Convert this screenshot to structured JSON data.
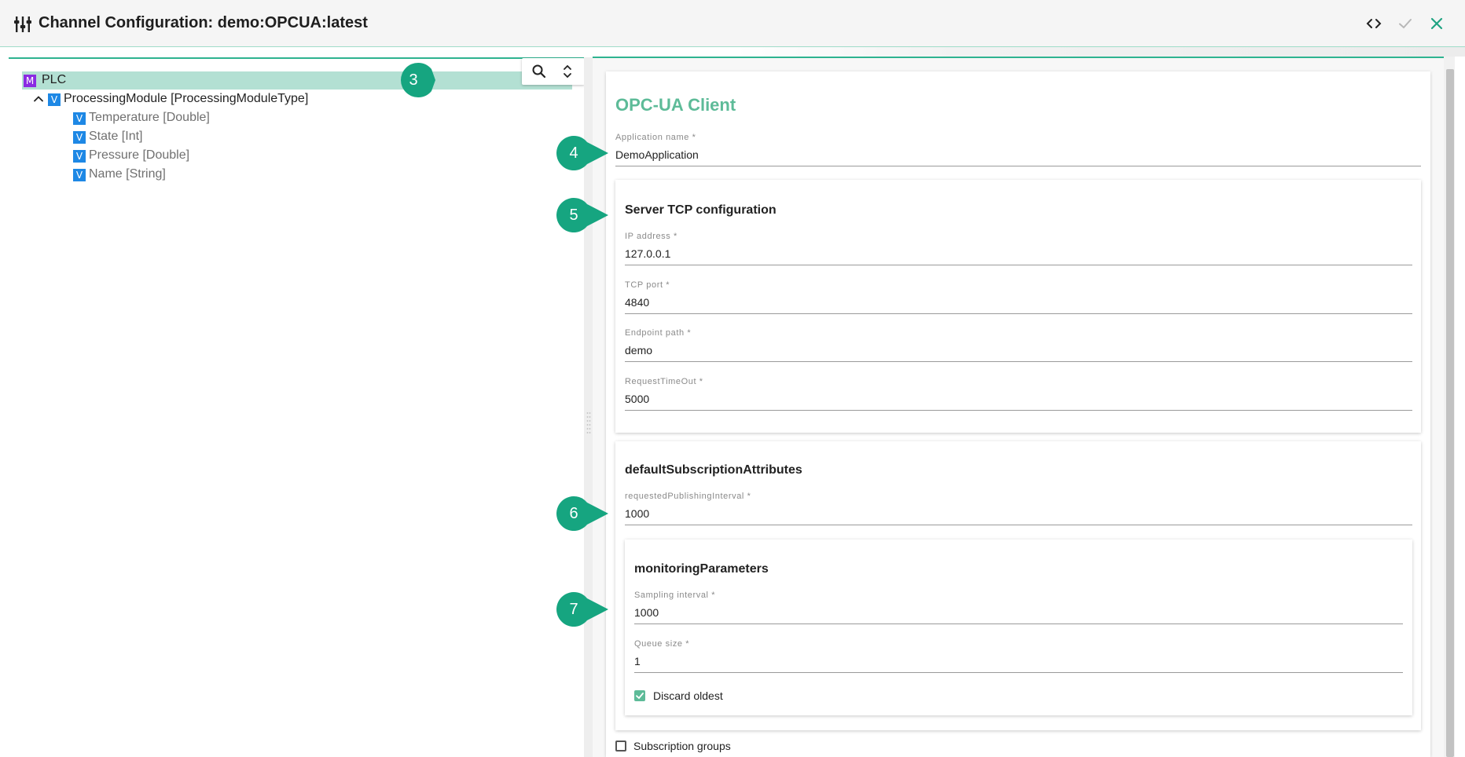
{
  "header": {
    "title": "Channel Configuration: demo:OPCUA:latest",
    "icon": "sliders-icon",
    "actions": [
      "code-icon",
      "check-icon",
      "close-icon"
    ]
  },
  "tree": {
    "items": [
      {
        "badge": "M",
        "label": "PLC",
        "selected": true
      },
      {
        "badge": "V",
        "label": "ProcessingModule [ProcessingModuleType]",
        "expanded": true
      },
      {
        "badge": "V",
        "label": "Temperature [Double]"
      },
      {
        "badge": "V",
        "label": "State [Int]"
      },
      {
        "badge": "V",
        "label": "Pressure [Double]"
      },
      {
        "badge": "V",
        "label": "Name [String]"
      }
    ],
    "toolbar": [
      "search-icon",
      "unfold-icon"
    ]
  },
  "form": {
    "title": "OPC-UA Client",
    "application_name": {
      "label": "Application name *",
      "value": "DemoApplication"
    },
    "server_tcp": {
      "title": "Server TCP configuration",
      "ip": {
        "label": "IP address *",
        "value": "127.0.0.1"
      },
      "port": {
        "label": "TCP port *",
        "value": "4840"
      },
      "endpoint": {
        "label": "Endpoint path *",
        "value": "demo"
      },
      "timeout": {
        "label": "RequestTimeOut *",
        "value": "5000"
      }
    },
    "subscription": {
      "title": "defaultSubscriptionAttributes",
      "publishing": {
        "label": "requestedPublishingInterval *",
        "value": "1000"
      },
      "monitoring": {
        "title": "monitoringParameters",
        "sampling": {
          "label": "Sampling interval *",
          "value": "1000"
        },
        "queue": {
          "label": "Queue size *",
          "value": "1"
        },
        "discard_oldest": {
          "label": "Discard oldest",
          "checked": true
        }
      }
    },
    "subscription_groups": {
      "label": "Subscription groups",
      "checked": false
    }
  },
  "callouts": [
    "3",
    "4",
    "5",
    "6",
    "7"
  ],
  "colors": {
    "accent": "#2eb390",
    "callout": "#16a580",
    "title_green": "#5dbb98",
    "selected_row": "#b3e0d3"
  }
}
